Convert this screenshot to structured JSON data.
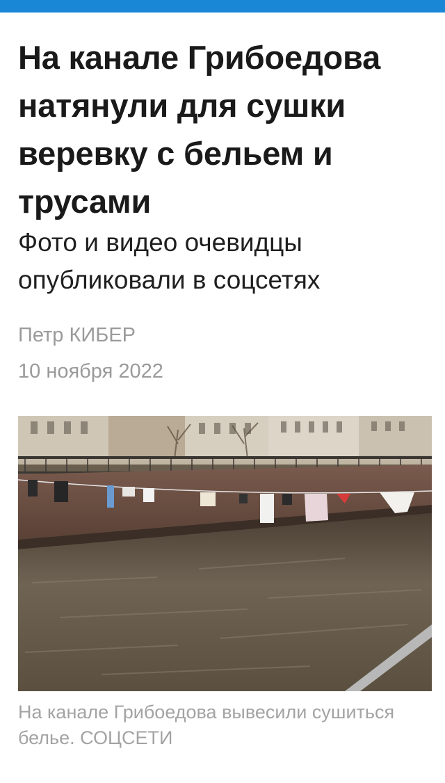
{
  "theme": {
    "accent": "#1a86d6",
    "text": "#1a1a1a",
    "muted": "#9a9a9a"
  },
  "article": {
    "headline": "На канале Грибоедова натянули для сушки веревку с бельем и трусами",
    "subheadline": "Фото и видео очевидцы опубликовали в соцсетях",
    "author": "Петр КИБЕР",
    "date": "10 ноября 2022",
    "caption": "На канале Грибоедова вывесили сушиться белье. СОЦСЕТИ"
  }
}
